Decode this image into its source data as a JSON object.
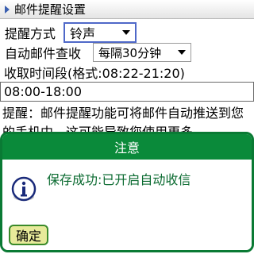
{
  "header": {
    "title": "邮件提醒设置",
    "icon": "triangle-right-icon"
  },
  "reminder_method": {
    "label": "提醒方式",
    "value": "铃声"
  },
  "auto_check": {
    "label": "自动邮件查收",
    "value": "每隔30分钟"
  },
  "time_range": {
    "label": "收取时间段(格式:08:22-21:20)",
    "value": "08:00-18:00"
  },
  "note": {
    "text": "提醒：邮件提醒功能可将邮件自动推送到您的手机中，这可能导致您使用更多"
  },
  "dialog": {
    "title": "注意",
    "icon": "info-icon",
    "message": "保存成功:已开启自动收信",
    "ok_label": "确定"
  },
  "colors": {
    "dialog_green": "#0a8a3a",
    "ok_button_bg": "#e7ea9a",
    "focus_blue": "#4f68c8"
  }
}
